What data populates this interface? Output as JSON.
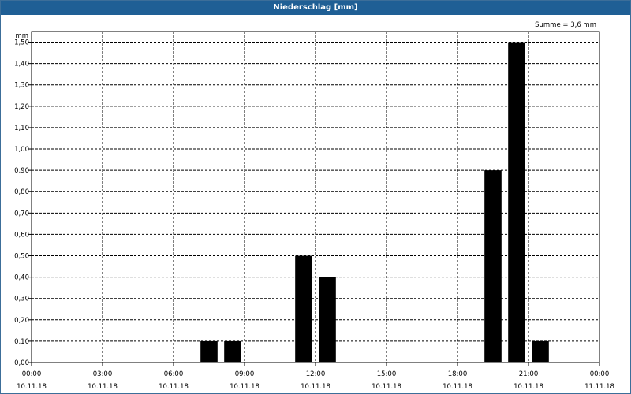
{
  "window": {
    "title": "Niederschlag [mm]"
  },
  "chart_data": {
    "type": "bar",
    "title": "Niederschlag [mm]",
    "ylabel": "mm",
    "summary": "Summe = 3,6 mm",
    "ylim": [
      0,
      1.55
    ],
    "xlim_hours": [
      0,
      24
    ],
    "grid": true,
    "yticks": [
      {
        "value": 0.0,
        "label": "0,00"
      },
      {
        "value": 0.1,
        "label": "0,10"
      },
      {
        "value": 0.2,
        "label": "0,20"
      },
      {
        "value": 0.3,
        "label": "0,30"
      },
      {
        "value": 0.4,
        "label": "0,40"
      },
      {
        "value": 0.5,
        "label": "0,50"
      },
      {
        "value": 0.6,
        "label": "0,60"
      },
      {
        "value": 0.7,
        "label": "0,70"
      },
      {
        "value": 0.8,
        "label": "0,80"
      },
      {
        "value": 0.9,
        "label": "0,90"
      },
      {
        "value": 1.0,
        "label": "1,00"
      },
      {
        "value": 1.1,
        "label": "1,10"
      },
      {
        "value": 1.2,
        "label": "1,20"
      },
      {
        "value": 1.3,
        "label": "1,30"
      },
      {
        "value": 1.4,
        "label": "1,40"
      },
      {
        "value": 1.5,
        "label": "1,50"
      }
    ],
    "xticks": [
      {
        "hour": 0,
        "time": "00:00",
        "date": "10.11.18"
      },
      {
        "hour": 3,
        "time": "03:00",
        "date": "10.11.18"
      },
      {
        "hour": 6,
        "time": "06:00",
        "date": "10.11.18"
      },
      {
        "hour": 9,
        "time": "09:00",
        "date": "10.11.18"
      },
      {
        "hour": 12,
        "time": "12:00",
        "date": "10.11.18"
      },
      {
        "hour": 15,
        "time": "15:00",
        "date": "10.11.18"
      },
      {
        "hour": 18,
        "time": "18:00",
        "date": "10.11.18"
      },
      {
        "hour": 21,
        "time": "21:00",
        "date": "10.11.18"
      },
      {
        "hour": 24,
        "time": "00:00",
        "date": "11.11.18"
      }
    ],
    "x": [
      "07:00",
      "08:00",
      "09:00",
      "10:00",
      "11:00",
      "12:00",
      "13:00",
      "14:00",
      "15:00",
      "16:00",
      "17:00",
      "18:00",
      "19:00",
      "20:00",
      "21:00"
    ],
    "values": [
      0.1,
      0.1,
      0.0,
      0.0,
      0.5,
      0.4,
      0.0,
      0.0,
      0.0,
      0.0,
      0.0,
      0.0,
      0.9,
      1.5,
      0.1
    ],
    "bar_color": "#000000",
    "grid_color": "#000000"
  }
}
